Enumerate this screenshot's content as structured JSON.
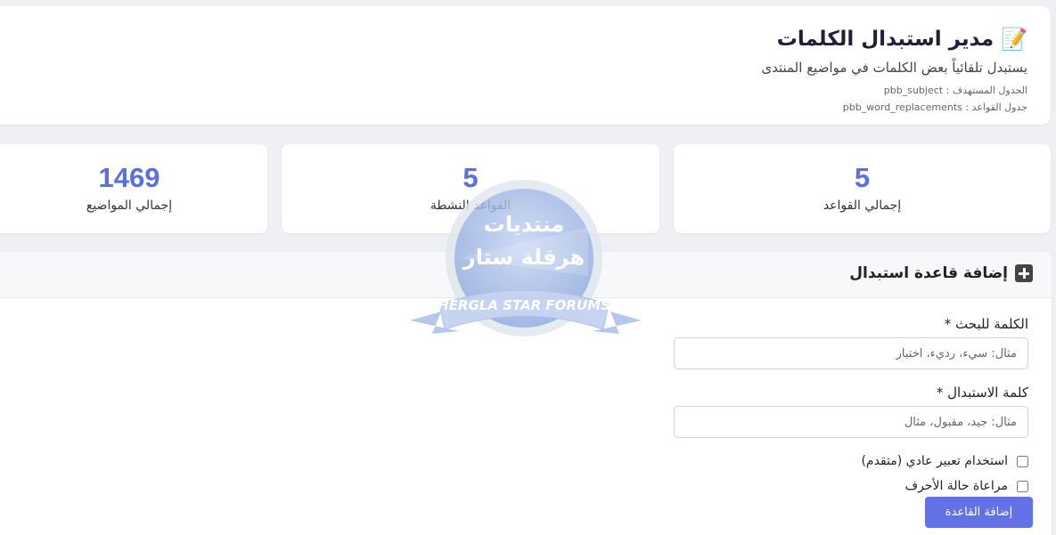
{
  "header": {
    "icon": "memo-pencil-icon",
    "icon_glyph": "📝",
    "title": "مدير استبدال الكلمات",
    "subtitle": "يستبدل تلقائياً بعض الكلمات في مواضيع المنتدى",
    "target_table_label": "الجدول المستهدف : pbb_subject",
    "rules_table_label": "جدول القواعد : pbb_word_replacements"
  },
  "stats": [
    {
      "value": "5",
      "label": "إجمالي القواعد"
    },
    {
      "value": "5",
      "label": "القواعد النشطة"
    },
    {
      "value": "1469",
      "label": "إجمالي المواضيع"
    }
  ],
  "add_rule": {
    "title": "إضافة قاعدة استبدال",
    "icon": "plus-icon",
    "search_label": "الكلمة للبحث *",
    "search_placeholder": "مثال: سيء، رديء، اختبار",
    "replace_label": "كلمة الاستبدال *",
    "replace_placeholder": "مثال: جيد، مقبول، مثال",
    "regex_label": "استخدام تعبير عادي (متقدم)",
    "case_label": "مراعاة حالة الأحرف",
    "submit_label": "إضافة القاعدة"
  },
  "watermark": {
    "arabic_line1": "منتديات",
    "arabic_line2": "هرقلة ستار",
    "banner": "HERGLA STAR FORUMS",
    "colors": {
      "disc": "#9eb8e8",
      "ribbon": "#b5c8ee",
      "text": "#ffffff"
    }
  },
  "colors": {
    "accent": "#5b6fe0",
    "button": "#6272e6",
    "background": "#eef0f3"
  }
}
